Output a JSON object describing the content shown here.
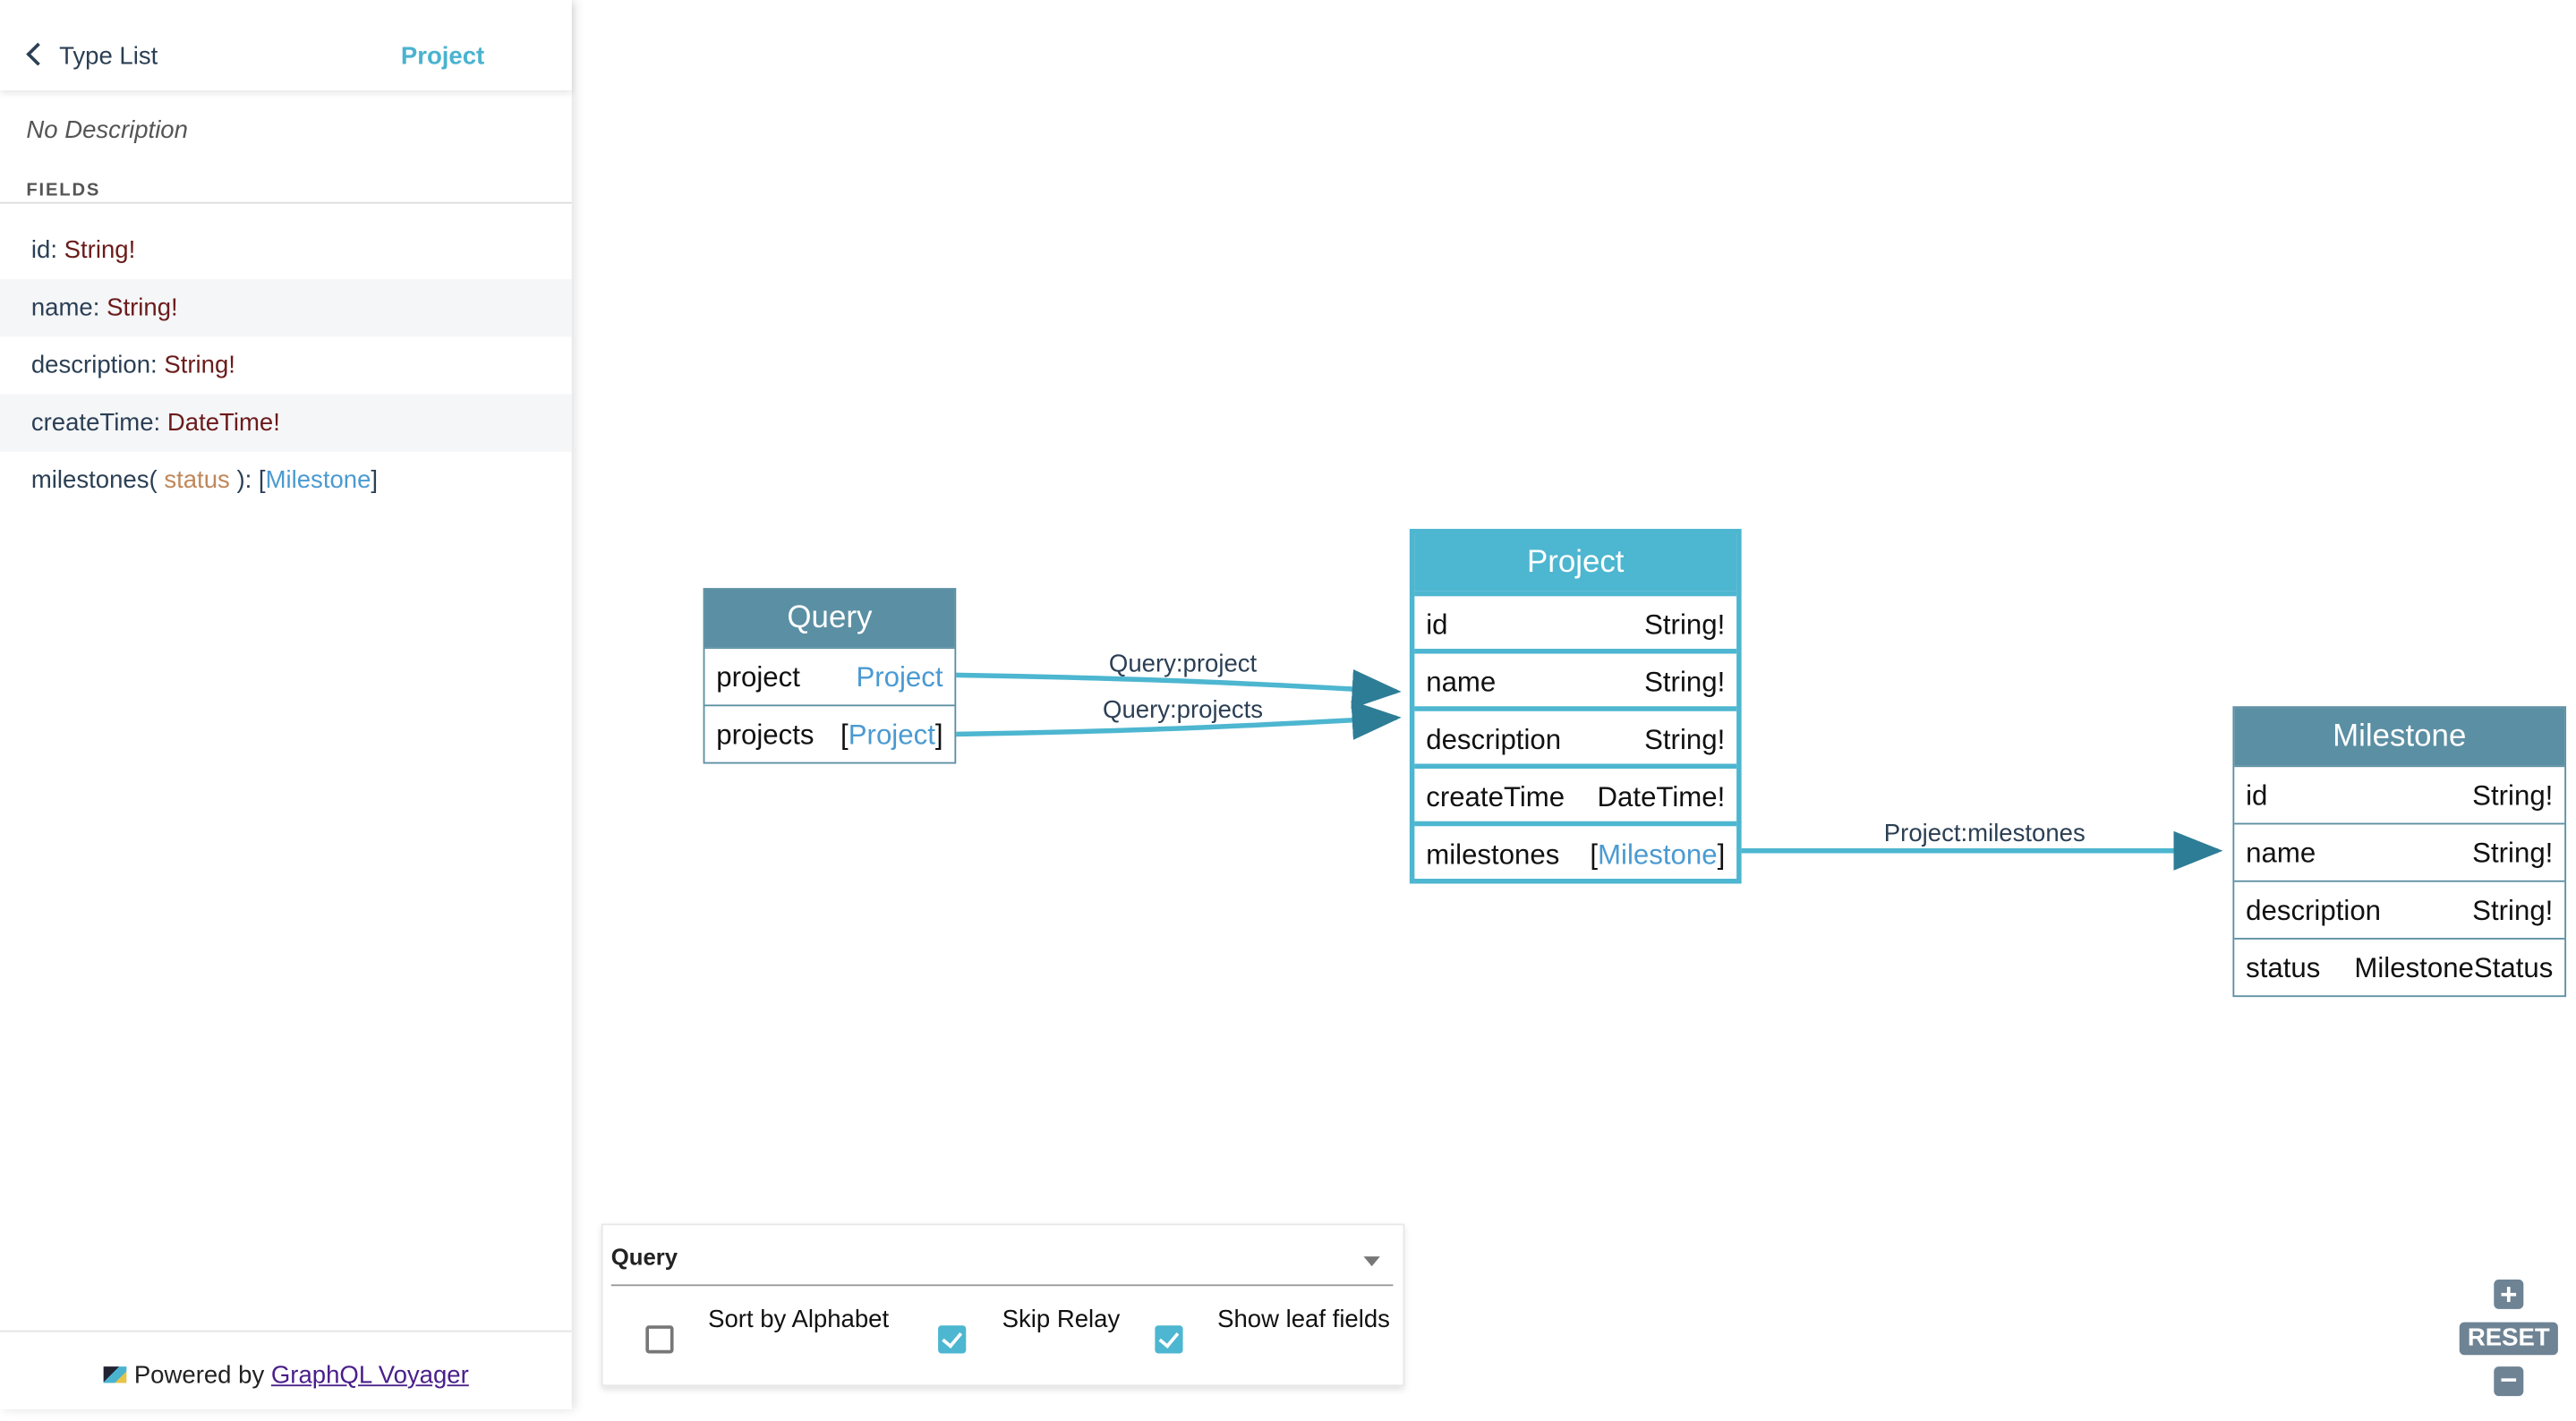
{
  "sidebar": {
    "back_label": "Type List",
    "title": "Project",
    "description": "No Description",
    "fields_heading": "FIELDS",
    "fields": [
      {
        "name": "id",
        "type": "String!"
      },
      {
        "name": "name",
        "type": "String!"
      },
      {
        "name": "description",
        "type": "String!"
      },
      {
        "name": "createTime",
        "type": "DateTime!"
      },
      {
        "name": "milestones",
        "arg": "status",
        "type": "Milestone"
      }
    ],
    "footer": {
      "prefix": "Powered by",
      "link": "GraphQL Voyager"
    }
  },
  "graph": {
    "query": {
      "title": "Query",
      "rows": [
        {
          "name": "project",
          "type": "Project",
          "list": false
        },
        {
          "name": "projects",
          "type": "Project",
          "list": true
        }
      ]
    },
    "project": {
      "title": "Project",
      "rows": [
        {
          "name": "id",
          "type": "String!"
        },
        {
          "name": "name",
          "type": "String!"
        },
        {
          "name": "description",
          "type": "String!"
        },
        {
          "name": "createTime",
          "type": "DateTime!"
        },
        {
          "name": "milestones",
          "type": "Milestone",
          "list": true
        }
      ]
    },
    "milestone": {
      "title": "Milestone",
      "rows": [
        {
          "name": "id",
          "type": "String!"
        },
        {
          "name": "name",
          "type": "String!"
        },
        {
          "name": "description",
          "type": "String!"
        },
        {
          "name": "status",
          "type": "MilestoneStatus"
        }
      ]
    },
    "edges": [
      "Query:project",
      "Query:projects",
      "Project:milestones"
    ],
    "colors": {
      "selected": "#4db6d0",
      "node": "#5b8fa3"
    }
  },
  "settings": {
    "root": "Query",
    "options": [
      {
        "label": "Sort by Alphabet",
        "checked": false
      },
      {
        "label": "Skip Relay",
        "checked": true
      },
      {
        "label": "Show leaf fields",
        "checked": true
      }
    ]
  },
  "zoom": {
    "reset": "RESET"
  }
}
